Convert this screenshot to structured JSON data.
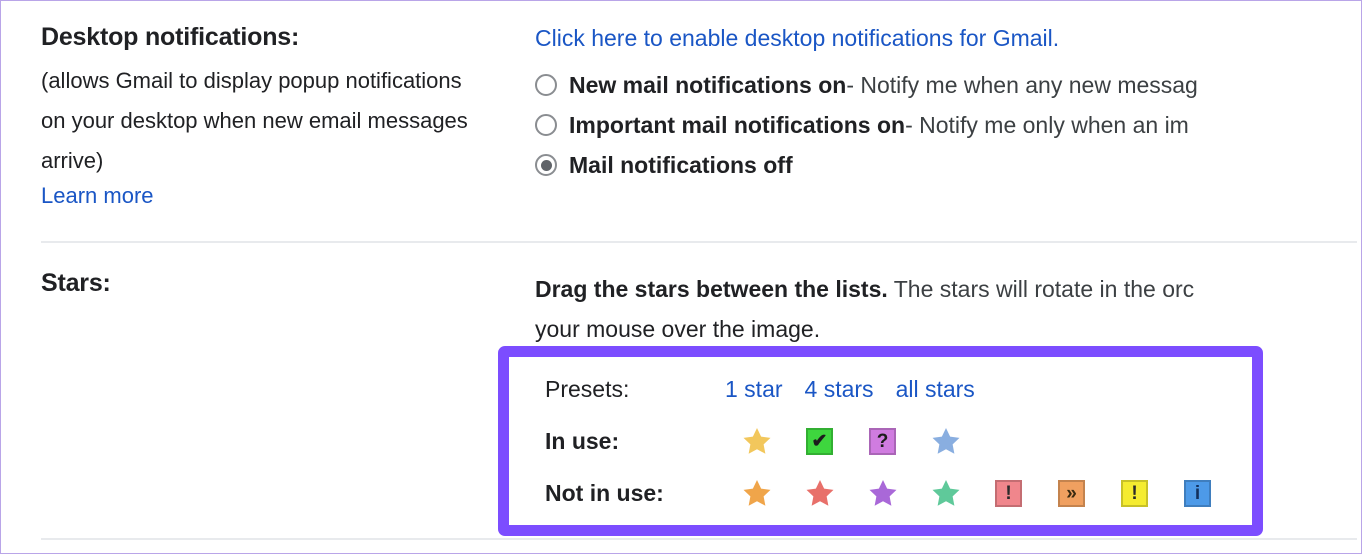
{
  "desktop_notifications": {
    "title": "Desktop notifications:",
    "description_lines": [
      "(allows Gmail to display popup notifications",
      "on your desktop when new email messages",
      "arrive)"
    ],
    "learn_more": "Learn more",
    "enable_link": "Click here to enable desktop notifications for Gmail.",
    "options": [
      {
        "strong": "New mail notifications on",
        "rest": " - Notify me when any new messag",
        "selected": false
      },
      {
        "strong": "Important mail notifications on",
        "rest": " - Notify me only when an im",
        "selected": false
      },
      {
        "strong": "Mail notifications off",
        "rest": "",
        "selected": true
      }
    ]
  },
  "stars": {
    "title": "Stars:",
    "intro_bold": "Drag the stars between the lists.",
    "intro_rest": "  The stars will rotate in the orc",
    "intro_line2": "your mouse over the image.",
    "presets_label": "Presets:",
    "presets": [
      "1 star",
      "4 stars",
      "all stars"
    ],
    "in_use_label": "In use:",
    "not_in_use_label": "Not in use:",
    "in_use_icons": [
      {
        "name": "yellow-star",
        "kind": "star",
        "color": "#f2c75c"
      },
      {
        "name": "green-check-box",
        "kind": "box",
        "color": "#3ed63e",
        "glyph": "✔",
        "glyph_color": "#1c1c1c"
      },
      {
        "name": "purple-question-box",
        "kind": "box",
        "color": "#d munged",
        "glyph": "?",
        "glyph_color": "#1c1c1c"
      },
      {
        "name": "blue-star",
        "kind": "star",
        "color": "#89aee0"
      }
    ],
    "not_in_use_icons": [
      {
        "name": "orange-star",
        "kind": "star",
        "color": "#f0a54a"
      },
      {
        "name": "red-star",
        "kind": "star",
        "color": "#e8706a"
      },
      {
        "name": "purple-star",
        "kind": "star",
        "color": "#a968d8"
      },
      {
        "name": "green-star",
        "kind": "star",
        "color": "#5fc99a"
      },
      {
        "name": "red-exclamation-box",
        "kind": "box",
        "color": "#f0868c",
        "glyph": "!",
        "glyph_color": "#2a2a2a"
      },
      {
        "name": "orange-double-chevron-box",
        "kind": "box",
        "color": "#f0a060",
        "glyph": "»",
        "glyph_color": "#3a2a10"
      },
      {
        "name": "yellow-exclamation-box",
        "kind": "box",
        "color": "#f5ec30",
        "glyph": "!",
        "glyph_color": "#2a2a2a"
      },
      {
        "name": "blue-info-box",
        "kind": "box",
        "color": "#4d9ae8",
        "glyph": "i",
        "glyph_color": "#13305c"
      }
    ]
  },
  "colors": {
    "link": "#1a56c5",
    "highlight_border": "#7c4dff",
    "divider": "#e8eaed"
  }
}
